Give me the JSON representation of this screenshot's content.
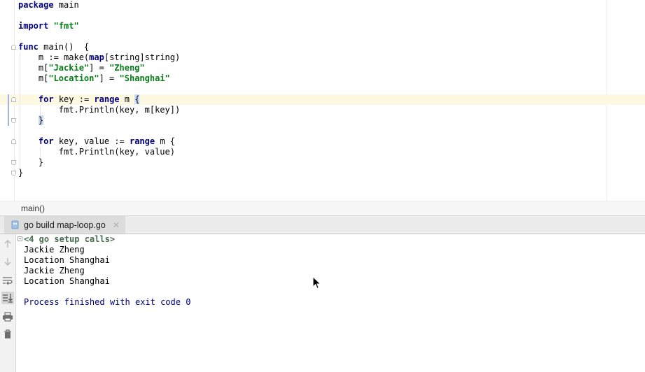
{
  "editor": {
    "lines": [
      {
        "parts": [
          {
            "t": "package",
            "c": "kw"
          },
          {
            "t": " main"
          }
        ]
      },
      {
        "parts": []
      },
      {
        "parts": [
          {
            "t": "import",
            "c": "kw"
          },
          {
            "t": " "
          },
          {
            "t": "\"fmt\"",
            "c": "str"
          }
        ]
      },
      {
        "parts": []
      },
      {
        "parts": [
          {
            "t": "func",
            "c": "kw"
          },
          {
            "t": " main()  {"
          }
        ]
      },
      {
        "parts": [
          {
            "t": "    m := make("
          },
          {
            "t": "map",
            "c": "kw"
          },
          {
            "t": "[string]string)"
          }
        ]
      },
      {
        "parts": [
          {
            "t": "    m["
          },
          {
            "t": "\"Jackie\"",
            "c": "str"
          },
          {
            "t": "] = "
          },
          {
            "t": "\"Zheng\"",
            "c": "str"
          }
        ]
      },
      {
        "parts": [
          {
            "t": "    m["
          },
          {
            "t": "\"Location\"",
            "c": "str"
          },
          {
            "t": "] = "
          },
          {
            "t": "\"Shanghai\"",
            "c": "str"
          }
        ]
      },
      {
        "parts": []
      },
      {
        "parts": [
          {
            "t": "    "
          },
          {
            "t": "for",
            "c": "kw"
          },
          {
            "t": " key := "
          },
          {
            "t": "range",
            "c": "kw"
          },
          {
            "t": " m "
          },
          {
            "t": "{",
            "c": "brace-hl"
          }
        ],
        "current": true
      },
      {
        "parts": [
          {
            "t": "        fmt.Println(key, m[key])"
          }
        ]
      },
      {
        "parts": [
          {
            "t": "    "
          },
          {
            "t": "}",
            "c": "brace-hl"
          }
        ]
      },
      {
        "parts": []
      },
      {
        "parts": [
          {
            "t": "    "
          },
          {
            "t": "for",
            "c": "kw"
          },
          {
            "t": " key, value := "
          },
          {
            "t": "range",
            "c": "kw"
          },
          {
            "t": " m {"
          }
        ]
      },
      {
        "parts": [
          {
            "t": "        fmt.Println(key, value)"
          }
        ]
      },
      {
        "parts": [
          {
            "t": "    }"
          }
        ]
      },
      {
        "parts": [
          {
            "t": "}"
          }
        ]
      }
    ]
  },
  "breadcrumb": {
    "label": "main()"
  },
  "run_window": {
    "tab_label": "go build map-loop.go",
    "tab_close": "✕",
    "console_lines": [
      {
        "text": "<4 go setup calls>",
        "kind": "setup"
      },
      {
        "text": "Jackie Zheng",
        "kind": "out"
      },
      {
        "text": "Location Shanghai",
        "kind": "out"
      },
      {
        "text": "Jackie Zheng",
        "kind": "out"
      },
      {
        "text": "Location Shanghai",
        "kind": "out"
      },
      {
        "text": "",
        "kind": "out"
      },
      {
        "text": "Process finished with exit code 0",
        "kind": "exit"
      }
    ]
  },
  "icons": {
    "toolbar": [
      "up-arrow-icon",
      "down-arrow-icon",
      "soft-wrap-icon",
      "scroll-to-end-icon",
      "print-icon",
      "trash-icon"
    ]
  }
}
